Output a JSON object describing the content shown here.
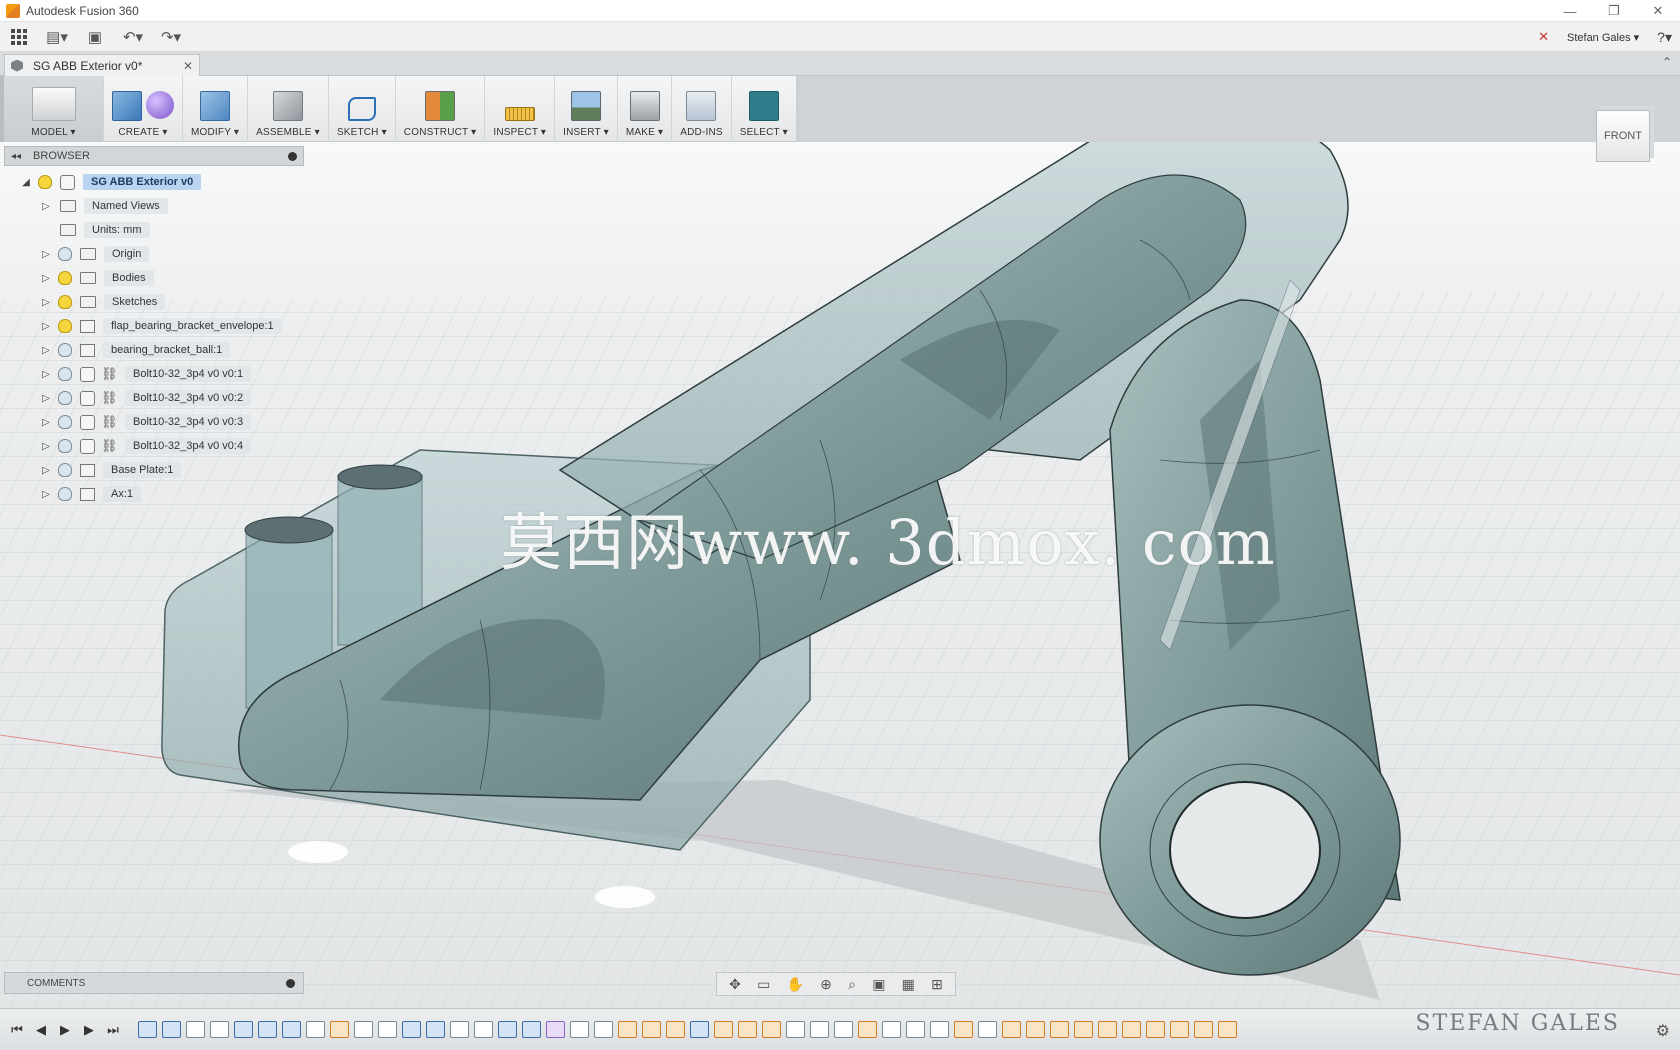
{
  "window": {
    "title": "Autodesk Fusion 360",
    "controls": [
      "—",
      "❐",
      "✕"
    ]
  },
  "quick_access": {
    "user": "Stefan Gales ▾",
    "help": "?▾"
  },
  "document_tab": {
    "label": "SG ABB Exterior v0*",
    "close": "✕"
  },
  "toolbar": {
    "groups": [
      {
        "id": "model",
        "label": "MODEL ▾"
      },
      {
        "id": "create",
        "label": "CREATE ▾"
      },
      {
        "id": "modify",
        "label": "MODIFY ▾"
      },
      {
        "id": "assemble",
        "label": "ASSEMBLE ▾"
      },
      {
        "id": "sketch",
        "label": "SKETCH ▾"
      },
      {
        "id": "construct",
        "label": "CONSTRUCT ▾"
      },
      {
        "id": "inspect",
        "label": "INSPECT ▾"
      },
      {
        "id": "insert",
        "label": "INSERT ▾"
      },
      {
        "id": "make",
        "label": "MAKE ▾"
      },
      {
        "id": "addins",
        "label": "ADD-INS"
      },
      {
        "id": "select",
        "label": "SELECT ▾"
      }
    ]
  },
  "viewcube": {
    "face": "FRONT"
  },
  "browser": {
    "title": "BROWSER",
    "items": [
      {
        "label": "SG ABB Exterior v0",
        "type": "root"
      },
      {
        "label": "Named Views",
        "type": "folder"
      },
      {
        "label": "Units: mm",
        "type": "units"
      },
      {
        "label": "Origin",
        "type": "folder"
      },
      {
        "label": "Bodies",
        "type": "folder"
      },
      {
        "label": "Sketches",
        "type": "folder"
      },
      {
        "label": "flap_bearing_bracket_envelope:1",
        "type": "component"
      },
      {
        "label": "bearing_bracket_ball:1",
        "type": "component"
      },
      {
        "label": "Bolt10-32_3p4 v0 v0:1",
        "type": "linked"
      },
      {
        "label": "Bolt10-32_3p4 v0 v0:2",
        "type": "linked"
      },
      {
        "label": "Bolt10-32_3p4 v0 v0:3",
        "type": "linked"
      },
      {
        "label": "Bolt10-32_3p4 v0 v0:4",
        "type": "linked"
      },
      {
        "label": "Base Plate:1",
        "type": "component"
      },
      {
        "label": "Ax:1",
        "type": "component"
      }
    ]
  },
  "comments": {
    "title": "COMMENTS"
  },
  "watermark": "莫西网www. 3dmox. com",
  "signature": "STEFAN GALES",
  "colors": {
    "part_fill": "#7f9b9a",
    "part_edge": "#2f3c3d",
    "select_accent": "#2f7d8c",
    "root_highlight": "#b9d3f0"
  }
}
